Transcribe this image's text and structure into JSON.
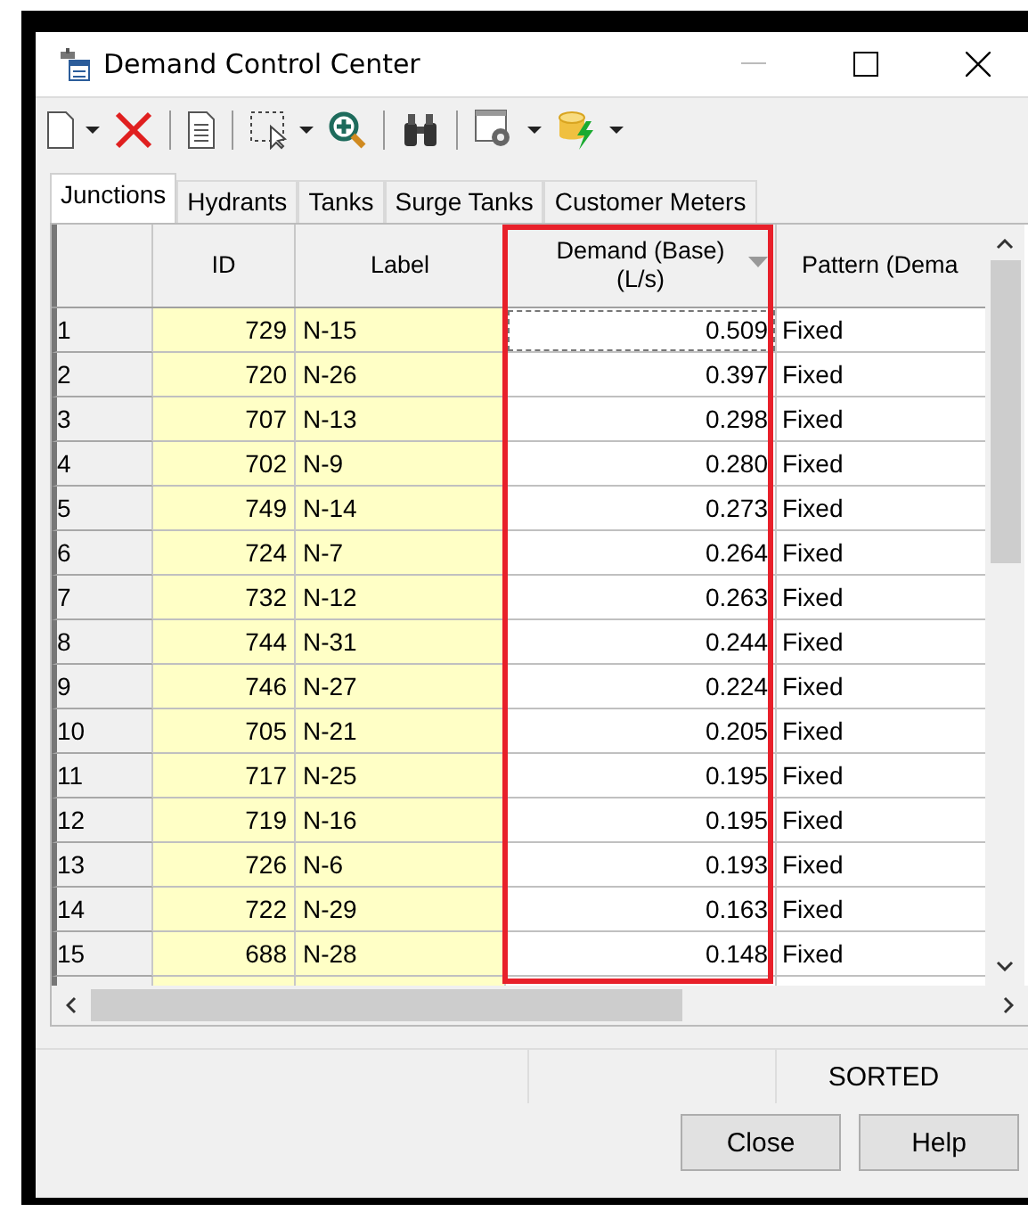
{
  "window": {
    "title": "Demand Control Center"
  },
  "tabs": [
    {
      "label": "Junctions",
      "selected": true
    },
    {
      "label": "Hydrants",
      "selected": false
    },
    {
      "label": "Tanks",
      "selected": false
    },
    {
      "label": "Surge Tanks",
      "selected": false
    },
    {
      "label": "Customer Meters",
      "selected": false
    }
  ],
  "table": {
    "columns": [
      {
        "label": "ID",
        "sorted": false
      },
      {
        "label": "Label",
        "sorted": false
      },
      {
        "label": "Demand (Base)\n(L/s)",
        "sorted": true
      },
      {
        "label": "Pattern (Dema",
        "sorted": false
      }
    ],
    "rows": [
      {
        "number": "1",
        "id": "729",
        "label": "N-15",
        "demand": "0.509",
        "pattern": "Fixed",
        "focused": true
      },
      {
        "number": "2",
        "id": "720",
        "label": "N-26",
        "demand": "0.397",
        "pattern": "Fixed",
        "focused": false
      },
      {
        "number": "3",
        "id": "707",
        "label": "N-13",
        "demand": "0.298",
        "pattern": "Fixed",
        "focused": false
      },
      {
        "number": "4",
        "id": "702",
        "label": "N-9",
        "demand": "0.280",
        "pattern": "Fixed",
        "focused": false
      },
      {
        "number": "5",
        "id": "749",
        "label": "N-14",
        "demand": "0.273",
        "pattern": "Fixed",
        "focused": false
      },
      {
        "number": "6",
        "id": "724",
        "label": "N-7",
        "demand": "0.264",
        "pattern": "Fixed",
        "focused": false
      },
      {
        "number": "7",
        "id": "732",
        "label": "N-12",
        "demand": "0.263",
        "pattern": "Fixed",
        "focused": false
      },
      {
        "number": "8",
        "id": "744",
        "label": "N-31",
        "demand": "0.244",
        "pattern": "Fixed",
        "focused": false
      },
      {
        "number": "9",
        "id": "746",
        "label": "N-27",
        "demand": "0.224",
        "pattern": "Fixed",
        "focused": false
      },
      {
        "number": "10",
        "id": "705",
        "label": "N-21",
        "demand": "0.205",
        "pattern": "Fixed",
        "focused": false
      },
      {
        "number": "11",
        "id": "717",
        "label": "N-25",
        "demand": "0.195",
        "pattern": "Fixed",
        "focused": false
      },
      {
        "number": "12",
        "id": "719",
        "label": "N-16",
        "demand": "0.195",
        "pattern": "Fixed",
        "focused": false
      },
      {
        "number": "13",
        "id": "726",
        "label": "N-6",
        "demand": "0.193",
        "pattern": "Fixed",
        "focused": false
      },
      {
        "number": "14",
        "id": "722",
        "label": "N-29",
        "demand": "0.163",
        "pattern": "Fixed",
        "focused": false
      },
      {
        "number": "15",
        "id": "688",
        "label": "N-28",
        "demand": "0.148",
        "pattern": "Fixed",
        "focused": false
      }
    ]
  },
  "status_bar": {
    "status": "SORTED"
  },
  "buttons": [
    "Close",
    "Help"
  ]
}
